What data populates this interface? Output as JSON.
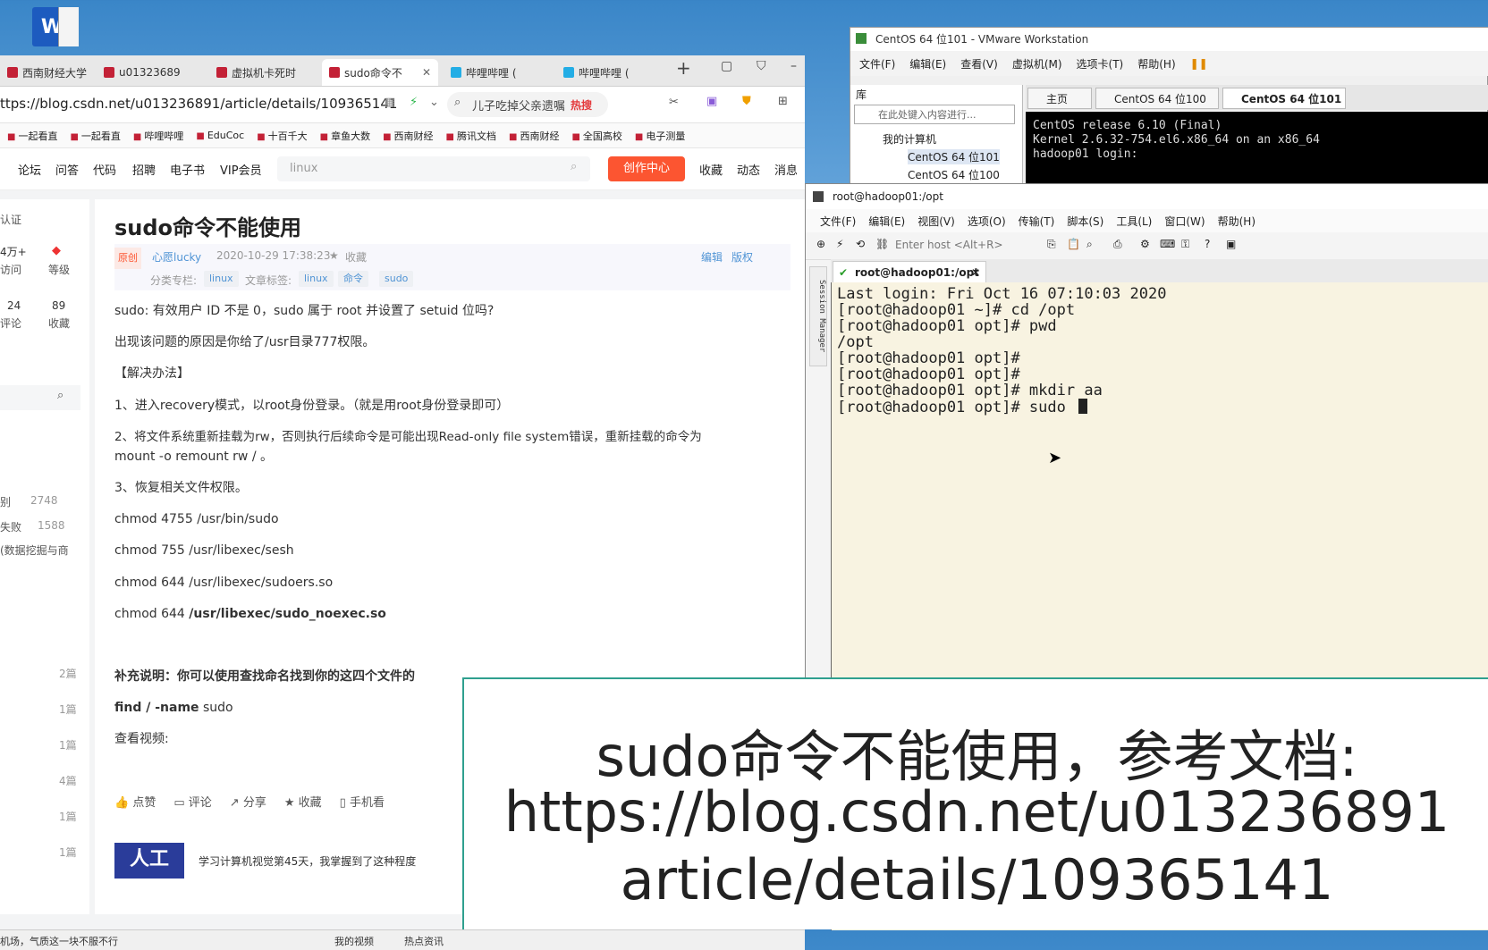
{
  "desktop": {
    "word_icon_label": "W"
  },
  "browser": {
    "tabs": [
      {
        "label": "西南财经大学",
        "icon": "csdn"
      },
      {
        "label": "u01323689",
        "icon": "csdn"
      },
      {
        "label": "虚拟机卡死时",
        "icon": "csdn"
      },
      {
        "label": "sudo命令不",
        "icon": "csdn",
        "active": true
      },
      {
        "label": "哔哩哔哩 (",
        "icon": "bili"
      },
      {
        "label": "哔哩哔哩 (",
        "icon": "bili"
      }
    ],
    "url": "ttps://blog.csdn.net/u013236891/article/details/109365141",
    "search_text": "儿子吃掉父亲遗嘱",
    "hot_label": "热搜",
    "bookmarks": [
      "一起看直",
      "一起看直",
      "哔哩哔哩",
      "EduCoc",
      "十百千大",
      "章鱼大数",
      "西南财经",
      "腾讯文档",
      "西南财经",
      "全国高校",
      "电子测量"
    ],
    "nav_links": [
      "论坛",
      "问答",
      "代码",
      "招聘",
      "电子书",
      "VIP会员"
    ],
    "nav_search_placeholder": "linux",
    "create_button": "创作中心",
    "nav_right": [
      "收藏",
      "动态",
      "消息"
    ]
  },
  "sidebar": {
    "cert": "认证",
    "stats": [
      {
        "value": "4万+",
        "label": "访问"
      },
      {
        "value": "",
        "label": "等级"
      },
      {
        "value": "24",
        "label": "评论"
      },
      {
        "value": "89",
        "label": "收藏"
      }
    ],
    "hot_items": [
      {
        "text": "别",
        "count": "2748"
      },
      {
        "text": "失败",
        "count": "1588"
      },
      {
        "text": "(数据挖掘与商",
        "count": ""
      }
    ],
    "category_counts": [
      "2篇",
      "1篇",
      "1篇",
      "4篇",
      "1篇",
      "1篇"
    ]
  },
  "article": {
    "title": "sudo命令不能使用",
    "original_badge": "原创",
    "author": "心愿lucky",
    "date": "2020-10-29 17:38:23",
    "favorite": "收藏",
    "edit": "编辑",
    "copyright": "版权",
    "category_label": "分类专栏:",
    "category_tag": "linux",
    "tags_label": "文章标签:",
    "tags": [
      "linux",
      "命令",
      "sudo"
    ],
    "paragraphs": [
      "sudo: 有效用户 ID 不是 0，sudo 属于 root 并设置了 setuid 位吗?",
      "出现该问题的原因是你给了/usr目录777权限。",
      "【解决办法】",
      "1、进入recovery模式，以root身份登录。（就是用root身份登录即可）",
      "2、将文件系统重新挂载为rw，否则执行后续命令是可能出现Read-only file system错误，重新挂载的命令为",
      "mount -o remount rw / 。",
      "3、恢复相关文件权限。",
      "chmod 4755 /usr/bin/sudo",
      "chmod  755  /usr/libexec/sesh",
      "chmod  644  /usr/libexec/sudoers.so",
      "chmod  644 ",
      "/usr/libexec/sudo_noexec.so",
      "补充说明：你可以使用查找命名找到你的这四个文件的",
      "find / -name",
      " sudo",
      "查看视频:"
    ],
    "actions": [
      "点赞",
      "评论",
      "分享",
      "收藏",
      "手机看"
    ],
    "rec_thumb": "人工",
    "rec_text": "学习计算机视觉第45天，我掌握到了这种程度"
  },
  "status_bar": {
    "left": "机场，气质这一块不服不行",
    "my_video": "我的视频",
    "hot": "热点资讯"
  },
  "vmware": {
    "title": "CentOS 64 位101 - VMware Workstation",
    "menu": [
      "文件(F)",
      "编辑(E)",
      "查看(V)",
      "虚拟机(M)",
      "选项卡(T)",
      "帮助(H)"
    ],
    "library_label": "库",
    "library_search": "在此处键入内容进行...",
    "tree": [
      "我的计算机",
      "CentOS 64 位101",
      "CentOS 64 位100"
    ],
    "tabs": [
      "主页",
      "CentOS 64 位100",
      "CentOS 64 位101"
    ],
    "console": [
      "CentOS release 6.10 (Final)",
      "Kernel 2.6.32-754.el6.x86_64 on an x86_64",
      "",
      "hadoop01 login:"
    ]
  },
  "xshell": {
    "title": "root@hadoop01:/opt",
    "menu": [
      "文件(F)",
      "编辑(E)",
      "视图(V)",
      "选项(O)",
      "传输(T)",
      "脚本(S)",
      "工具(L)",
      "窗口(W)",
      "帮助(H)"
    ],
    "host_placeholder": "Enter host <Alt+R>",
    "tab": "root@hadoop01:/opt",
    "session_manager": "Session Manager",
    "lines": [
      "Last login: Fri Oct 16 07:10:03 2020",
      "[root@hadoop01 ~]# cd /opt",
      "[root@hadoop01 opt]# pwd",
      "/opt",
      "[root@hadoop01 opt]#",
      "[root@hadoop01 opt]#",
      "[root@hadoop01 opt]# mkdir aa",
      "[root@hadoop01 opt]# sudo "
    ]
  },
  "caption": {
    "line1": "sudo命令不能使用，参考文档:",
    "line2": "https://blog.csdn.net/u013236891",
    "line3": "article/details/109365141"
  }
}
